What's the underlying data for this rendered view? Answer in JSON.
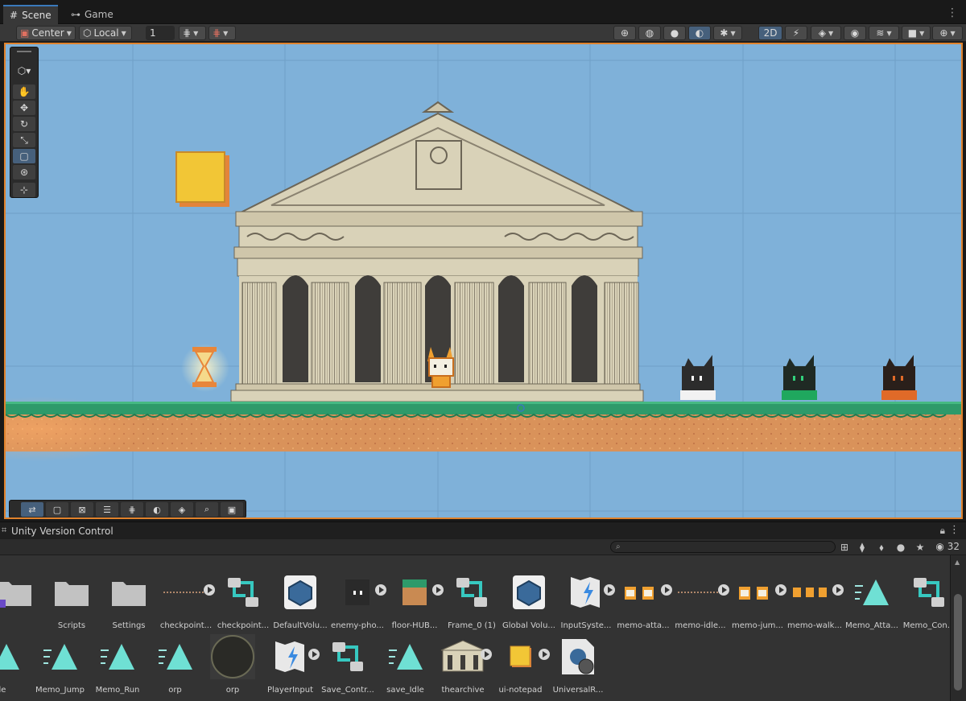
{
  "tabs": [
    {
      "label": "Scene",
      "icon": "grid-icon",
      "active": true
    },
    {
      "label": "Game",
      "icon": "gamepad-icon",
      "active": false
    }
  ],
  "scene_toolbar": {
    "pivot_mode": "Center",
    "pivot_rotation": "Local",
    "grid_increment": "1",
    "mode_2d": "2D"
  },
  "version_control": {
    "title": "Unity Version Control"
  },
  "project_toolbar": {
    "search_value": "",
    "visible_count": "32"
  },
  "assets_row1": [
    {
      "label": "",
      "kind": "folder-shortcut"
    },
    {
      "label": "Scripts",
      "kind": "folder"
    },
    {
      "label": "Settings",
      "kind": "folder"
    },
    {
      "label": "checkpoint...",
      "kind": "line-anim"
    },
    {
      "label": "checkpoint...",
      "kind": "anim-controller"
    },
    {
      "label": "DefaultVolu...",
      "kind": "volume"
    },
    {
      "label": "enemy-pho...",
      "kind": "sprite-dark"
    },
    {
      "label": "floor-HUB...",
      "kind": "sprite-grass"
    },
    {
      "label": "Frame_0 (1)",
      "kind": "anim-controller"
    },
    {
      "label": "Global Volu...",
      "kind": "volume"
    },
    {
      "label": "InputSyste...",
      "kind": "input-asset"
    },
    {
      "label": "memo-atta...",
      "kind": "sprite-cat"
    },
    {
      "label": "memo-idle...",
      "kind": "line-anim"
    },
    {
      "label": "memo-jum...",
      "kind": "sprite-cat"
    },
    {
      "label": "memo-walk...",
      "kind": "sprite-cat-small"
    },
    {
      "label": "Memo_Atta...",
      "kind": "anim-clip"
    },
    {
      "label": "Memo_Con...",
      "kind": "anim-controller"
    }
  ],
  "assets_row2": [
    {
      "label": "le",
      "kind": "anim-clip"
    },
    {
      "label": "Memo_Jump",
      "kind": "anim-clip"
    },
    {
      "label": "Memo_Run",
      "kind": "anim-clip"
    },
    {
      "label": "orp",
      "kind": "anim-clip"
    },
    {
      "label": "orp",
      "kind": "render-texture"
    },
    {
      "label": "PlayerInput",
      "kind": "input-asset"
    },
    {
      "label": "Save_Contr...",
      "kind": "anim-controller"
    },
    {
      "label": "save_Idle",
      "kind": "anim-clip"
    },
    {
      "label": "thearchive",
      "kind": "sprite-temple"
    },
    {
      "label": "ui-notepad",
      "kind": "sprite-notepad"
    },
    {
      "label": "UniversalR...",
      "kind": "render-pipeline"
    }
  ],
  "colors": {
    "sky": "#7fb1d9",
    "viewport_border": "#e0822c",
    "grass": "#2e9a6a",
    "dirt": "#d9925a",
    "temple": "#d9d2b8",
    "accent_blue": "#3a79bb"
  }
}
